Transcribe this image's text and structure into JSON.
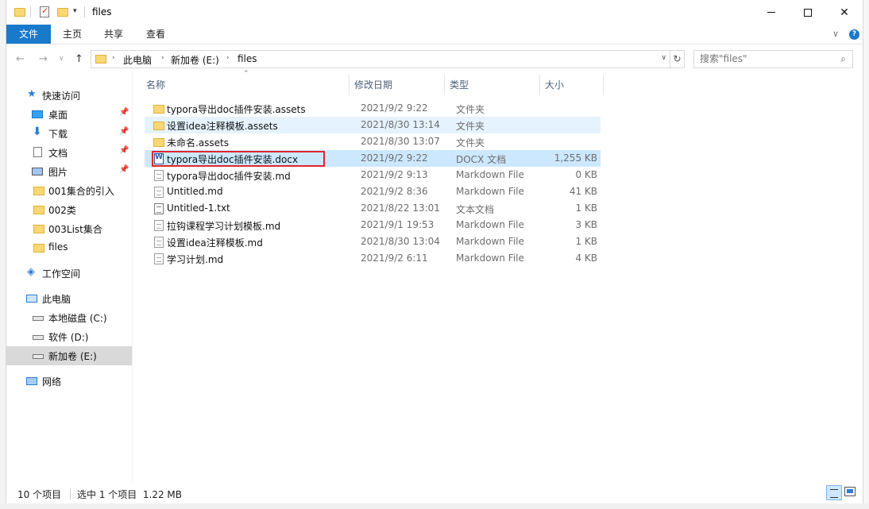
{
  "window": {
    "title": "files"
  },
  "ribbon": {
    "tabs": [
      "文件",
      "主页",
      "共享",
      "查看"
    ]
  },
  "address_bar": {
    "breadcrumbs": [
      "此电脑",
      "新加卷 (E:)",
      "files"
    ]
  },
  "search": {
    "placeholder": "搜索\"files\""
  },
  "sidebar": {
    "quick_access": "快速访问",
    "items": [
      {
        "label": "桌面",
        "icon": "desktop-icon",
        "pinned": true
      },
      {
        "label": "下载",
        "icon": "download-icon",
        "pinned": true
      },
      {
        "label": "文档",
        "icon": "document-icon",
        "pinned": true
      },
      {
        "label": "图片",
        "icon": "picture-icon",
        "pinned": true
      },
      {
        "label": "001集合的引入",
        "icon": "folder-icon"
      },
      {
        "label": "002类",
        "icon": "folder-icon"
      },
      {
        "label": "003List集合",
        "icon": "folder-icon"
      },
      {
        "label": "files",
        "icon": "folder-icon"
      }
    ],
    "workspace": "工作空间",
    "this_pc": "此电脑",
    "drives": [
      {
        "label": "本地磁盘 (C:)"
      },
      {
        "label": "软件 (D:)"
      },
      {
        "label": "新加卷 (E:)",
        "active": true
      }
    ],
    "network": "网络"
  },
  "columns": {
    "name": "名称",
    "date": "修改日期",
    "type": "类型",
    "size": "大小"
  },
  "files": [
    {
      "name": "typora导出doc插件安装.assets",
      "date": "2021/9/2 9:22",
      "type": "文件夹",
      "size": "",
      "icon": "folder-icon"
    },
    {
      "name": "设置idea注释模板.assets",
      "date": "2021/8/30 13:14",
      "type": "文件夹",
      "size": "",
      "icon": "folder-icon",
      "state": "hover"
    },
    {
      "name": "未命名.assets",
      "date": "2021/8/30 13:07",
      "type": "文件夹",
      "size": "",
      "icon": "folder-icon"
    },
    {
      "name": "typora导出doc插件安装.docx",
      "date": "2021/9/2 9:22",
      "type": "DOCX 文档",
      "size": "1,255 KB",
      "icon": "word-document-icon",
      "state": "selected"
    },
    {
      "name": "typora导出doc插件安装.md",
      "date": "2021/9/2 9:13",
      "type": "Markdown File",
      "size": "0 KB",
      "icon": "markdown-file-icon"
    },
    {
      "name": "Untitled.md",
      "date": "2021/9/2 8:36",
      "type": "Markdown File",
      "size": "41 KB",
      "icon": "markdown-file-icon"
    },
    {
      "name": "Untitled-1.txt",
      "date": "2021/8/22 13:01",
      "type": "文本文档",
      "size": "1 KB",
      "icon": "text-file-icon"
    },
    {
      "name": "拉钩课程学习计划模板.md",
      "date": "2021/9/1 19:53",
      "type": "Markdown File",
      "size": "3 KB",
      "icon": "markdown-file-icon"
    },
    {
      "name": "设置idea注释模板.md",
      "date": "2021/8/30 13:04",
      "type": "Markdown File",
      "size": "1 KB",
      "icon": "markdown-file-icon"
    },
    {
      "name": "学习计划.md",
      "date": "2021/9/2 6:11",
      "type": "Markdown File",
      "size": "4 KB",
      "icon": "markdown-file-icon"
    }
  ],
  "status": {
    "item_count": "10 个项目",
    "selection": "选中 1 个项目  1.22 MB"
  }
}
